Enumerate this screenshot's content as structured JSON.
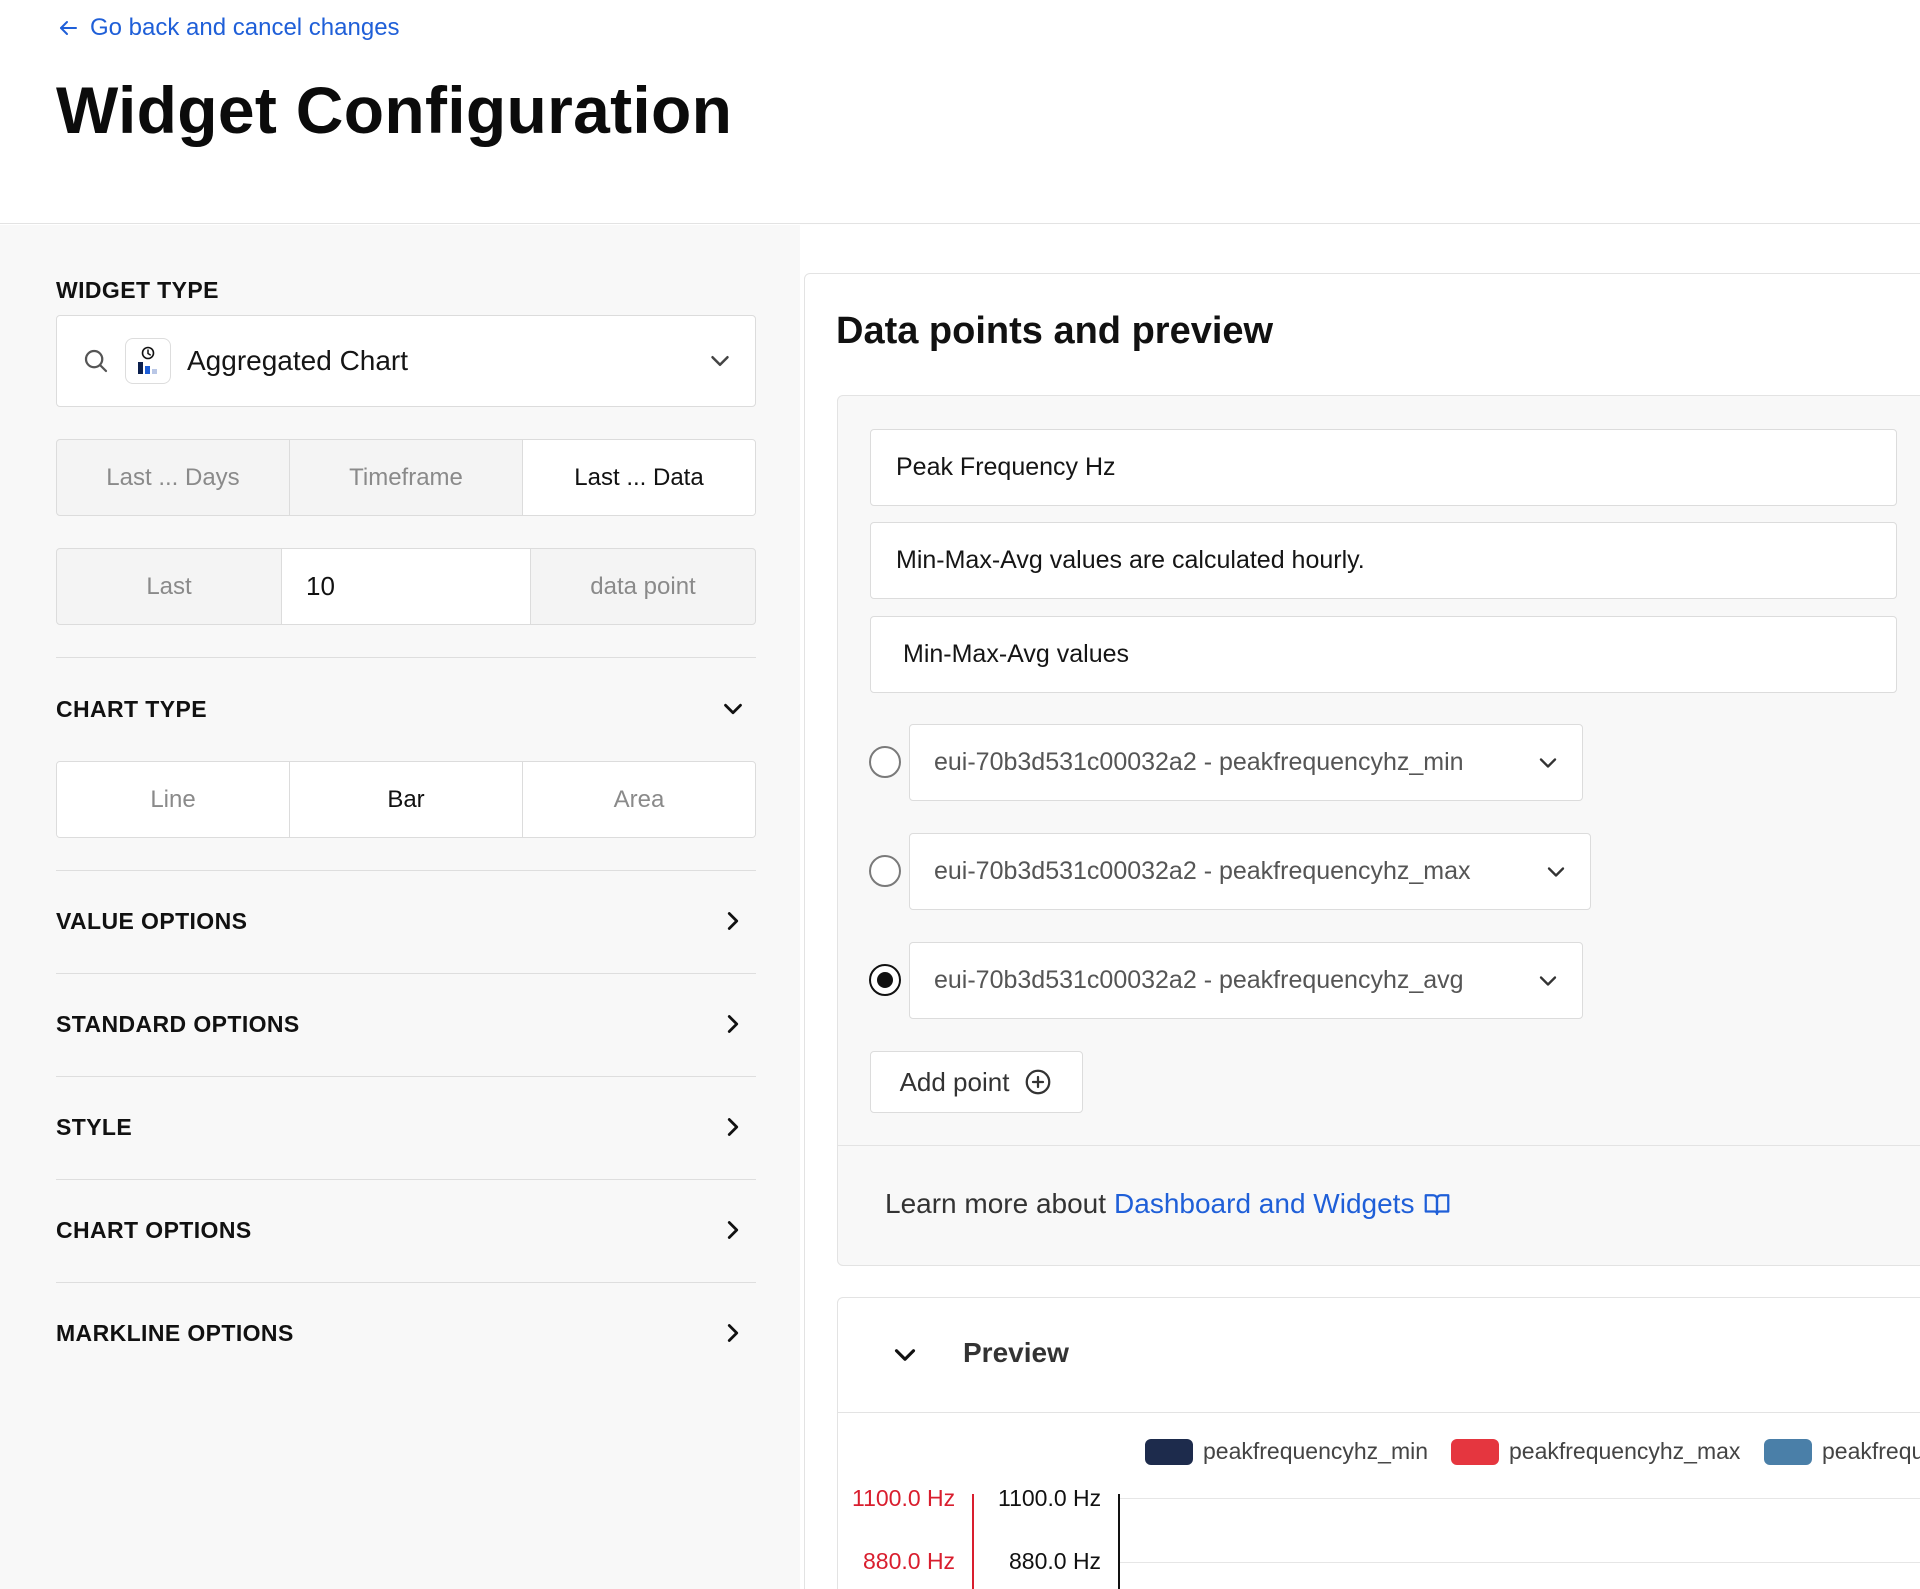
{
  "header": {
    "back_link": "Go back and cancel changes",
    "title": "Widget Configuration"
  },
  "widget_type": {
    "label": "WIDGET TYPE",
    "selected": "Aggregated Chart",
    "range_tabs": [
      "Last ... Days",
      "Timeframe",
      "Last ... Data"
    ],
    "active_range_tab": "Last ... Data",
    "last_label": "Last",
    "last_value": "10",
    "unit_label": "data point"
  },
  "chart_type": {
    "label": "CHART TYPE",
    "options": [
      "Line",
      "Bar",
      "Area"
    ],
    "selected": "Bar"
  },
  "sections": [
    "VALUE OPTIONS",
    "STANDARD OPTIONS",
    "STYLE",
    "CHART OPTIONS",
    "MARKLINE OPTIONS"
  ],
  "panel": {
    "title": "Data points and preview",
    "widget_title": "Peak Frequency Hz",
    "description": "Min-Max-Avg values are calculated hourly.",
    "subtitle": "Min-Max-Avg values",
    "data_points": [
      "eui-70b3d531c00032a2 - peakfrequencyhz_min",
      "eui-70b3d531c00032a2 - peakfrequencyhz_max",
      "eui-70b3d531c00032a2 - peakfrequencyhz_avg"
    ],
    "selected_point": "eui-70b3d531c00032a2 - peakfrequencyhz_avg",
    "add_point": "Add point",
    "learn_prefix": "Learn more about",
    "learn_link": "Dashboard and Widgets"
  },
  "preview": {
    "title": "Preview",
    "legend": [
      "peakfrequencyhz_min",
      "peakfrequencyhz_max",
      "peakfrequ"
    ],
    "legend_colors": [
      "#1d2b4c",
      "#e5363f",
      "#4a7fa8"
    ],
    "left_axis_ticks": [
      "1100.0 Hz",
      "880.0 Hz"
    ],
    "right_axis_ticks": [
      "1100.0 Hz",
      "880.0 Hz"
    ],
    "axis_colors": {
      "left": "#d91e2e",
      "right": "#111111"
    }
  }
}
